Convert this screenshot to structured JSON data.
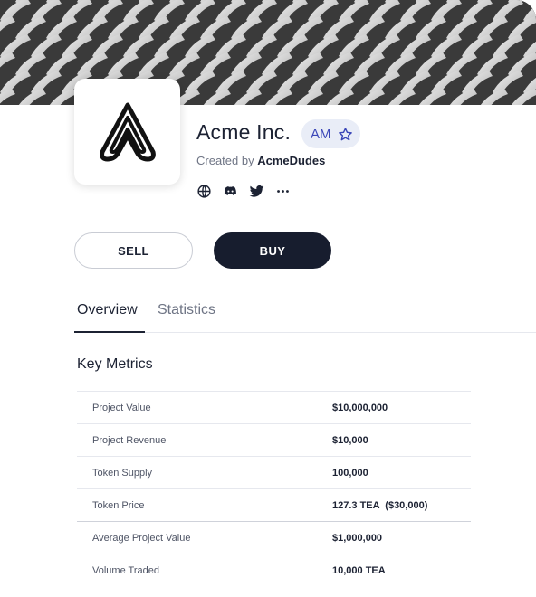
{
  "project": {
    "name": "Acme Inc.",
    "ticker": "AM",
    "created_by_prefix": "Created by",
    "creator": "AcmeDudes"
  },
  "socials": [
    "globe-icon",
    "discord-icon",
    "twitter-icon",
    "more-icon"
  ],
  "actions": {
    "sell_label": "SELL",
    "buy_label": "BUY"
  },
  "tabs": [
    {
      "label": "Overview",
      "active": true
    },
    {
      "label": "Statistics",
      "active": false
    }
  ],
  "key_metrics": {
    "title": "Key Metrics",
    "rows": [
      {
        "label": "Project Value",
        "value": "$10,000,000"
      },
      {
        "label": "Project Revenue",
        "value": "$10,000"
      },
      {
        "label": "Token Supply",
        "value": "100,000"
      },
      {
        "label": "Token Price",
        "value": "127.3 TEA  ($30,000)"
      },
      {
        "label": "Average Project Value",
        "value": "$1,000,000"
      },
      {
        "label": "Volume Traded",
        "value": "10,000 TEA"
      }
    ]
  },
  "colors": {
    "buy_button": "#171d2e",
    "badge_bg": "#e9edf7",
    "badge_text": "#3a46b8"
  }
}
